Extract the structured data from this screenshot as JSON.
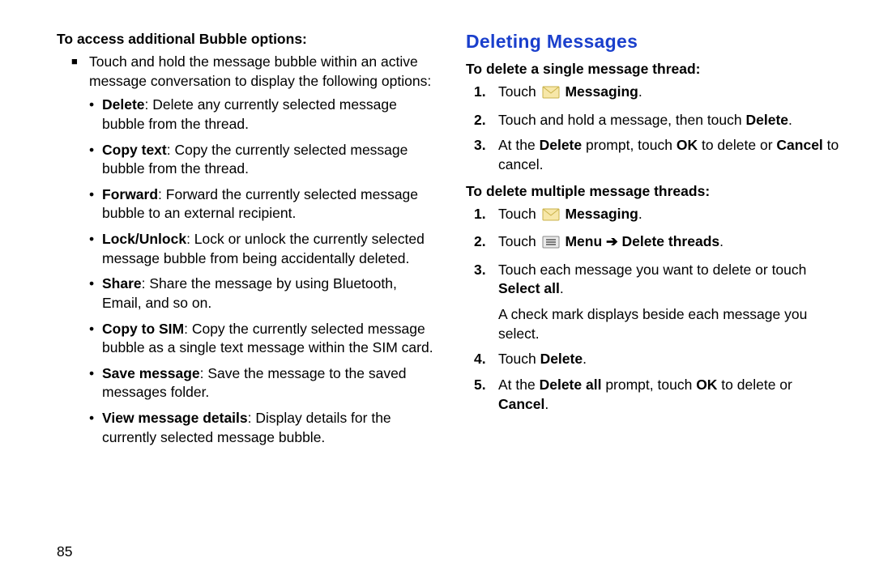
{
  "left": {
    "subhead": "To access additional Bubble options:",
    "intro": "Touch and hold the message bubble within an active message conversation to display the following options:",
    "bullets": [
      {
        "term": "Delete",
        "desc": ": Delete any currently selected message bubble from the thread."
      },
      {
        "term": "Copy text",
        "desc": ": Copy the currently selected message bubble from the thread."
      },
      {
        "term": "Forward",
        "desc": ": Forward the currently selected message bubble to an external recipient."
      },
      {
        "term": "Lock/Unlock",
        "desc": ": Lock or unlock the currently selected message bubble from being accidentally deleted."
      },
      {
        "term": "Share",
        "desc": ": Share the message by using Bluetooth, Email, and so on."
      },
      {
        "term": "Copy to SIM",
        "desc": ": Copy the currently selected message bubble as a single text message within the SIM card."
      },
      {
        "term": "Save message",
        "desc": ": Save the message to the saved messages folder."
      },
      {
        "term": "View message details",
        "desc": ": Display details for the currently selected message bubble."
      }
    ]
  },
  "right": {
    "title": "Deleting Messages",
    "sec1": {
      "subhead": "To delete a single message thread:",
      "s1_pre": "Touch ",
      "s1_bold": "Messaging",
      "s1_post": ".",
      "s2_pre": "Touch and hold a message, then touch ",
      "s2_bold": "Delete",
      "s2_post": ".",
      "s3_a": "At the ",
      "s3_b": "Delete",
      "s3_c": " prompt, touch ",
      "s3_d": "OK",
      "s3_e": " to delete or ",
      "s3_f": "Cancel",
      "s3_g": " to cancel."
    },
    "sec2": {
      "subhead": "To delete multiple message threads:",
      "s1_pre": "Touch ",
      "s1_bold": "Messaging",
      "s1_post": ".",
      "s2_pre": "Touch ",
      "s2_bold": "Menu ➔ Delete threads",
      "s2_post": ".",
      "s3_pre": "Touch each message you want to delete or touch ",
      "s3_bold": "Select all",
      "s3_post": ".",
      "s3_note": "A check mark displays beside each message you select.",
      "s4_pre": "Touch ",
      "s4_bold": "Delete",
      "s4_post": ".",
      "s5_a": "At the ",
      "s5_b": "Delete all",
      "s5_c": " prompt, touch ",
      "s5_d": "OK",
      "s5_e": " to delete or ",
      "s5_f": "Cancel",
      "s5_g": "."
    }
  },
  "pagenum": "85",
  "nums": {
    "n1": "1.",
    "n2": "2.",
    "n3": "3.",
    "n4": "4.",
    "n5": "5."
  },
  "marks": {
    "square": "■",
    "bullet": "•"
  }
}
